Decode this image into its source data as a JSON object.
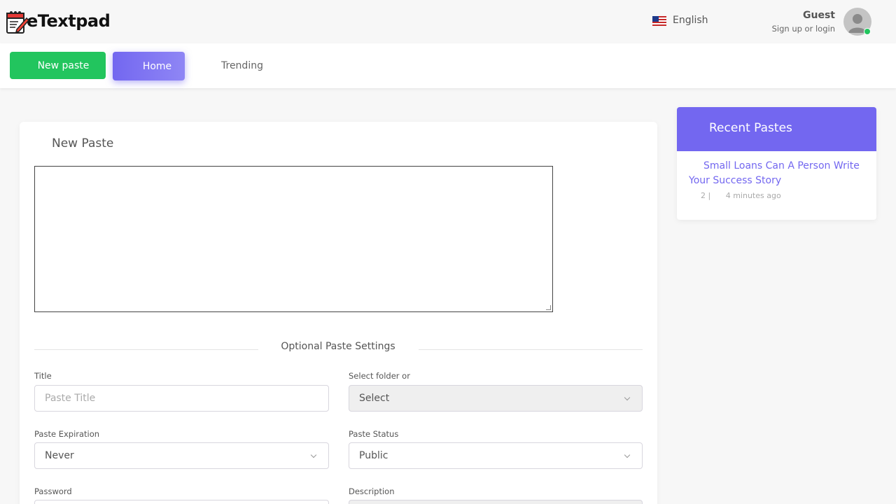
{
  "header": {
    "logo_text": "eTextpad",
    "language": "English",
    "user_name": "Guest",
    "user_sub": "Sign up or login"
  },
  "nav": {
    "new_paste": "New paste",
    "home": "Home",
    "trending": "Trending"
  },
  "form": {
    "title": "New Paste",
    "optional_settings": "Optional Paste Settings",
    "title_label": "Title",
    "title_placeholder": "Paste Title",
    "folder_label": "Select folder or",
    "folder_value": "Select",
    "expiration_label": "Paste Expiration",
    "expiration_value": "Never",
    "status_label": "Paste Status",
    "status_value": "Public",
    "password_label": "Password",
    "description_label": "Description"
  },
  "sidebar": {
    "title": "Recent Pastes",
    "items": [
      {
        "title": "Small Loans Can A Person Write Your Success Story",
        "count": "2 |",
        "time": "4 minutes ago"
      }
    ]
  },
  "colors": {
    "accent": "#7367f0",
    "success": "#22c55e"
  }
}
